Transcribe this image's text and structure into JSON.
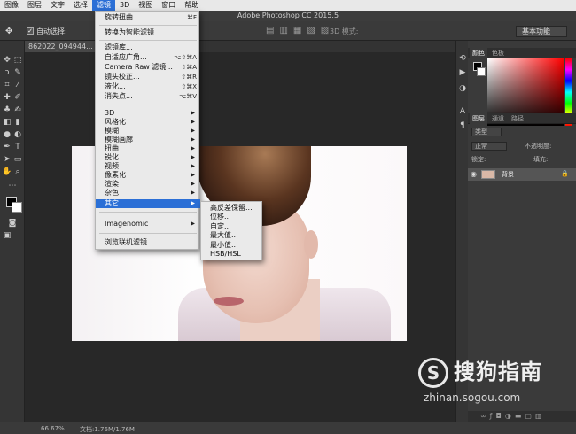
{
  "menubar": {
    "items": [
      "图像",
      "图层",
      "文字",
      "选择",
      "滤镜",
      "3D",
      "视图",
      "窗口",
      "帮助"
    ],
    "active_index": 4
  },
  "app": {
    "title": "Adobe Photoshop CC 2015.5"
  },
  "optionsbar": {
    "auto_select_label": "自动选择:",
    "workspace_label": "基本功能",
    "three_d_label": "3D 模式:"
  },
  "document": {
    "tab_label": "862022_094944..."
  },
  "filter_menu": {
    "last_filter": {
      "label": "旋转扭曲",
      "shortcut": "⌘F"
    },
    "convert_smart": "转换为智能滤镜",
    "gallery": "滤镜库...",
    "adaptive_wide": {
      "label": "自适应广角...",
      "shortcut": "⌥⇧⌘A"
    },
    "camera_raw": {
      "label": "Camera Raw 滤镜...",
      "shortcut": "⇧⌘A"
    },
    "lens_correction": {
      "label": "镜头校正...",
      "shortcut": "⇧⌘R"
    },
    "liquify": {
      "label": "液化...",
      "shortcut": "⇧⌘X"
    },
    "vanishing_point": {
      "label": "消失点...",
      "shortcut": "⌥⌘V"
    },
    "groups": [
      "3D",
      "风格化",
      "模糊",
      "模糊画廊",
      "扭曲",
      "锐化",
      "视频",
      "像素化",
      "渲染",
      "杂色",
      "其它"
    ],
    "highlighted_group": "其它",
    "imagenomic": "Imagenomic",
    "browse_online": "浏览联机滤镜..."
  },
  "submenu": {
    "items": [
      "高反差保留...",
      "位移...",
      "自定...",
      "最大值...",
      "最小值...",
      "HSB/HSL"
    ]
  },
  "panels": {
    "color_tabs": [
      "颜色",
      "色板"
    ],
    "layer_tabs": [
      "图层",
      "通道",
      "路径"
    ],
    "kind_label": "类型",
    "blend_mode": "正常",
    "opacity_label": "不透明度:",
    "lock_label": "锁定:",
    "fill_label": "填充:",
    "layer_name": "背景"
  },
  "status": {
    "zoom": "66.67%",
    "doc_size": "文档:1.76M/1.76M"
  },
  "watermark": {
    "logo_glyph": "S",
    "name": "搜狗指南",
    "url": "zhinan.sogou.com"
  },
  "colors": {
    "menu_highlight": "#2b6fd6",
    "workspace_bg": "#282828",
    "panel_bg": "#3a3a3a"
  }
}
